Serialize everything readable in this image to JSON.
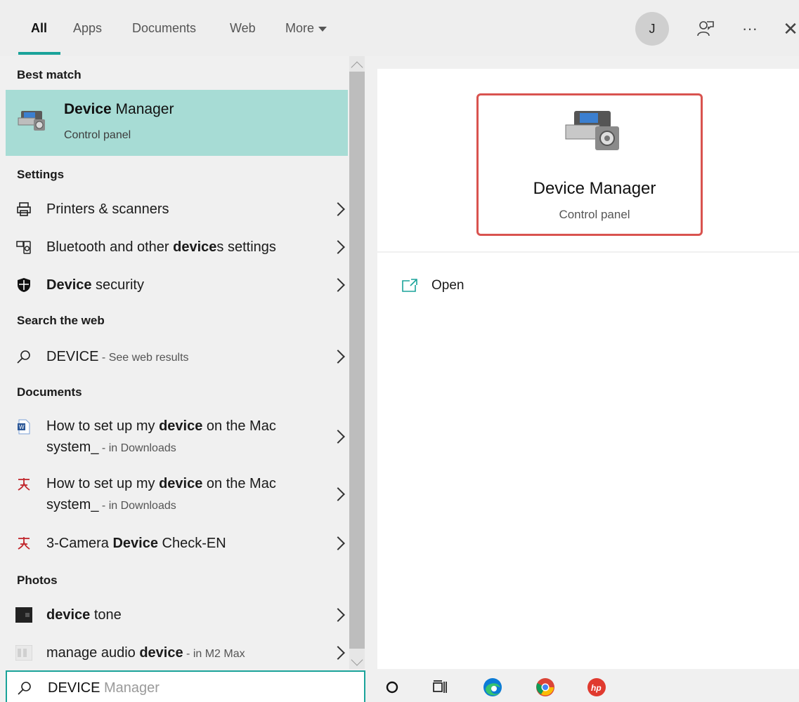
{
  "tabs": {
    "all": "All",
    "apps": "Apps",
    "documents": "Documents",
    "web": "Web",
    "more": "More"
  },
  "account": {
    "initial": "J"
  },
  "top_icons": {
    "feedback": "feedback-icon",
    "more": "···",
    "close": "✕"
  },
  "best_match": {
    "heading": "Best match",
    "title_bold": "Device",
    "title_rest": " Manager",
    "subtitle": "Control panel"
  },
  "settings": {
    "heading": "Settings",
    "items": [
      {
        "pre": "Printers & scanners",
        "bold": "",
        "post": ""
      },
      {
        "pre": "Bluetooth and other ",
        "bold": "device",
        "post": "s settings"
      },
      {
        "pre": "",
        "bold": "Device",
        "post": " security"
      }
    ]
  },
  "web": {
    "heading": "Search the web",
    "query": "DEVICE",
    "suffix": " - See web results"
  },
  "documents": {
    "heading": "Documents",
    "items": [
      {
        "pre": "How to set up my ",
        "bold": "device",
        "post": " on the Mac",
        "line2": "system_",
        "loc": " - in Downloads"
      },
      {
        "pre": "How to set up my ",
        "bold": "device",
        "post": " on the Mac",
        "line2": "system_",
        "loc": " - in Downloads"
      },
      {
        "pre": "3-Camera ",
        "bold": "Device",
        "post": " Check-EN"
      }
    ]
  },
  "photos": {
    "heading": "Photos",
    "items": [
      {
        "pre": "",
        "bold": "device",
        "post": " tone",
        "loc": ""
      },
      {
        "pre": "manage audio ",
        "bold": "device",
        "post": "",
        "loc": " - in M2 Max"
      }
    ]
  },
  "detail": {
    "title": "Device Manager",
    "subtitle": "Control panel",
    "actions": [
      {
        "label": "Open"
      }
    ]
  },
  "search": {
    "typed": "DEVICE",
    "ghost": " Manager"
  },
  "colors": {
    "accent": "#1aa39a",
    "best_match_bg": "#a7dcd5",
    "highlight_border": "#d9534f"
  }
}
